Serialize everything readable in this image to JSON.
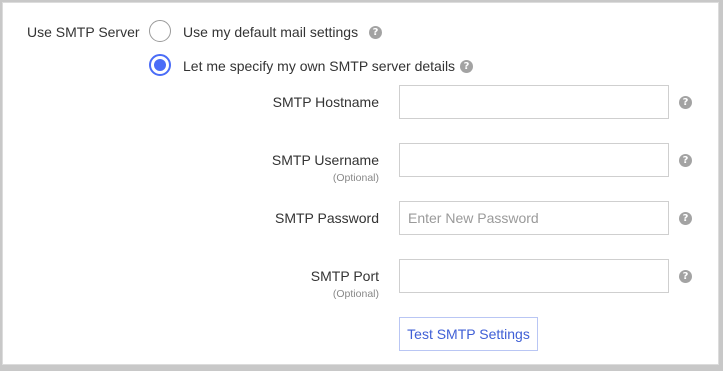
{
  "smtp": {
    "section_label": "Use SMTP Server",
    "options": [
      {
        "label": "Use my default mail settings",
        "selected": false
      },
      {
        "label": "Let me specify my own SMTP server details",
        "selected": true
      }
    ],
    "help_glyph": "?",
    "fields": {
      "hostname": {
        "label": "SMTP Hostname",
        "sublabel": "",
        "value": "",
        "placeholder": ""
      },
      "username": {
        "label": "SMTP Username",
        "sublabel": "(Optional)",
        "value": "",
        "placeholder": ""
      },
      "password": {
        "label": "SMTP Password",
        "sublabel": "",
        "value": "",
        "placeholder": "Enter New Password"
      },
      "port": {
        "label": "SMTP Port",
        "sublabel": "(Optional)",
        "value": "",
        "placeholder": ""
      }
    },
    "test_button_label": "Test SMTP Settings"
  },
  "icons": {
    "help": "question-circle-icon",
    "radio_on": "radio-selected",
    "radio_off": "radio-unselected"
  },
  "colors": {
    "accent": "#4a6cf7",
    "button_text": "#3f5fd6",
    "help_icon": "#a3a3a3",
    "background": "#c8c8c8"
  }
}
